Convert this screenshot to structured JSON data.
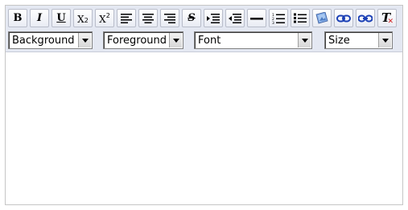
{
  "toolbar": {
    "buttons": [
      {
        "name": "bold-button",
        "glyph": "B",
        "icon": "bold-icon"
      },
      {
        "name": "italic-button",
        "glyph": "I",
        "icon": "italic-icon"
      },
      {
        "name": "underline-button",
        "glyph": "U",
        "icon": "underline-icon"
      },
      {
        "name": "subscript-button",
        "glyph": "X",
        "icon": "subscript-icon"
      },
      {
        "name": "superscript-button",
        "glyph": "X",
        "icon": "superscript-icon"
      },
      {
        "name": "align-left-button",
        "icon": "align-left-icon"
      },
      {
        "name": "align-center-button",
        "icon": "align-center-icon"
      },
      {
        "name": "align-right-button",
        "icon": "align-right-icon"
      },
      {
        "name": "strikethrough-button",
        "glyph": "S",
        "icon": "strikethrough-icon"
      },
      {
        "name": "indent-button",
        "icon": "indent-icon"
      },
      {
        "name": "outdent-button",
        "icon": "outdent-icon"
      },
      {
        "name": "horizontal-rule-button",
        "icon": "horizontal-rule-icon"
      },
      {
        "name": "ordered-list-button",
        "icon": "ordered-list-icon"
      },
      {
        "name": "unordered-list-button",
        "icon": "unordered-list-icon"
      },
      {
        "name": "insert-image-button",
        "icon": "image-icon"
      },
      {
        "name": "create-link-button",
        "icon": "link-icon"
      },
      {
        "name": "remove-link-button",
        "icon": "unlink-icon"
      },
      {
        "name": "remove-format-button",
        "glyph": "T",
        "icon": "remove-format-icon"
      }
    ],
    "selects": {
      "background": "Background",
      "foreground": "Foreground",
      "font": "Font",
      "size": "Size"
    }
  }
}
